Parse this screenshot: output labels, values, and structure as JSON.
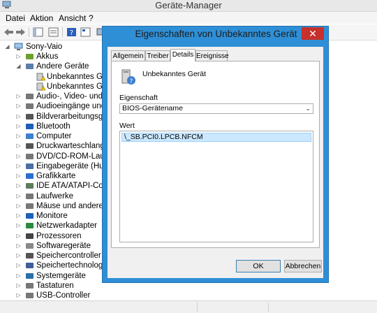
{
  "window": {
    "title": "Geräte-Manager"
  },
  "menu": [
    "Datei",
    "Aktion",
    "Ansicht",
    "?"
  ],
  "tree": {
    "root": "Sony-Vaio",
    "items": [
      "Akkus",
      "Andere Geräte",
      "Unbekanntes Gerät",
      "Unbekanntes Gerät",
      "Audio-, Video- und Ga",
      "Audioeingänge und -a",
      "Bildverarbeitungsgerät",
      "Bluetooth",
      "Computer",
      "Druckwarteschlangen",
      "DVD/CD-ROM-Laufwe",
      "Eingabegeräte (Human",
      "Grafikkarte",
      "IDE ATA/ATAPI-Contro",
      "Laufwerke",
      "Mäuse und andere Zei",
      "Monitore",
      "Netzwerkadapter",
      "Prozessoren",
      "Softwaregeräte",
      "Speichercontroller",
      "Speichertechnologiege",
      "Systemgeräte",
      "Tastaturen",
      "USB-Controller"
    ]
  },
  "dialog": {
    "title": "Eigenschaften von Unbekanntes Gerät",
    "close": "✕",
    "tabs": [
      "Allgemein",
      "Treiber",
      "Details",
      "Ereignisse"
    ],
    "device_name": "Unbekanntes Gerät",
    "property_label": "Eigenschaft",
    "property_value": "BIOS-Gerätename",
    "value_label": "Wert",
    "value_item": "\\_SB.PCI0.LPCB.NFCM",
    "ok_label": "OK",
    "cancel_label": "Abbrechen"
  },
  "colors": {
    "dialog_frame": "#2f8fd6",
    "close_button": "#c7302b",
    "selection": "#cce8ff"
  }
}
